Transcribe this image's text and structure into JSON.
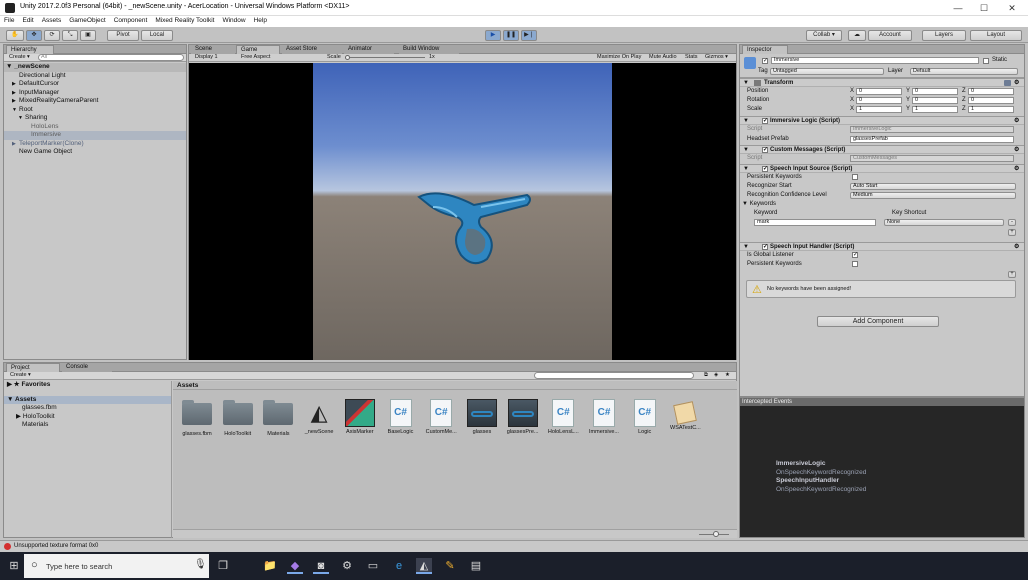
{
  "window": {
    "title": "Unity 2017.2.0f3 Personal (64bit) - _newScene.unity - AcerLocation - Universal Windows Platform <DX11>",
    "minimize": "—",
    "maximize": "☐",
    "close": "✕"
  },
  "menu": [
    "File",
    "Edit",
    "Assets",
    "GameObject",
    "Component",
    "Mixed Reality Toolkit",
    "Window",
    "Help"
  ],
  "toolbar": {
    "pivot": "Pivot",
    "local": "Local",
    "collab": "Collab ▾",
    "account": "Account",
    "layers": "Layers",
    "layout": "Layout"
  },
  "hierarchy": {
    "tab": "Hierarchy",
    "create": "Create ▾",
    "search_placeholder": "All",
    "scene": "_newScene",
    "items": [
      {
        "label": "Directional Light",
        "indent": 1,
        "arrow": ""
      },
      {
        "label": "DefaultCursor",
        "indent": 1,
        "arrow": "▶"
      },
      {
        "label": "InputManager",
        "indent": 1,
        "arrow": "▶"
      },
      {
        "label": "MixedRealityCameraParent",
        "indent": 1,
        "arrow": "▶"
      },
      {
        "label": "Root",
        "indent": 1,
        "arrow": "▼"
      },
      {
        "label": "Sharing",
        "indent": 2,
        "arrow": "▼"
      },
      {
        "label": "HoloLens",
        "indent": 3,
        "arrow": ""
      },
      {
        "label": "Immersive",
        "indent": 3,
        "arrow": ""
      },
      {
        "label": "TeleportMarker(Clone)",
        "indent": 1,
        "arrow": "▶"
      },
      {
        "label": "New Game Object",
        "indent": 1,
        "arrow": ""
      }
    ]
  },
  "center_tabs": {
    "scene": "Scene",
    "game": "Game",
    "asset_store": "Asset Store",
    "animator": "Animator",
    "build_window": "Build Window"
  },
  "game_bar": {
    "display": "Display 1",
    "aspect": "Free Aspect",
    "scale_label": "Scale",
    "scale_value": "1x",
    "maximize": "Maximize On Play",
    "mute": "Mute Audio",
    "stats": "Stats",
    "gizmos": "Gizmos ▾"
  },
  "inspector": {
    "tab": "Inspector",
    "name": "Immersive",
    "static": "Static",
    "tag_label": "Tag",
    "tag": "Untagged",
    "layer_label": "Layer",
    "layer": "Default",
    "transform": {
      "title": "Transform",
      "position": "Position",
      "rotation": "Rotation",
      "scale": "Scale",
      "pos": [
        "0",
        "0",
        "0"
      ],
      "rot": [
        "0",
        "0",
        "0"
      ],
      "scl": [
        "1",
        "1",
        "1"
      ]
    },
    "immersive_logic": {
      "title": "Immersive Logic (Script)",
      "script_label": "Script",
      "script": "ImmersiveLogic",
      "prefab_label": "Headset Prefab",
      "prefab": "glassesPrefab"
    },
    "custom_messages": {
      "title": "Custom Messages (Script)",
      "script_label": "Script",
      "script": "CustomMessages"
    },
    "speech_source": {
      "title": "Speech Input Source (Script)",
      "persistent": "Persistent Keywords",
      "recognizer_label": "Recognizer Start",
      "recognizer": "Auto Start",
      "confidence_label": "Recognition Confidence Level",
      "confidence": "Medium",
      "keywords": "Keywords",
      "keyword_col": "Keyword",
      "shortcut_col": "Key Shortcut",
      "keyword": "mark",
      "shortcut": "None"
    },
    "speech_handler": {
      "title": "Speech Input Handler (Script)",
      "global": "Is Global Listener",
      "persistent": "Persistent Keywords",
      "warning": "No keywords have been assigned!"
    },
    "add_component": "Add Component"
  },
  "events": {
    "title": "Intercepted Events",
    "lines": [
      "ImmersiveLogic",
      "OnSpeechKeywordRecognized",
      "SpeechInputHandler",
      "OnSpeechKeywordRecognized"
    ]
  },
  "project": {
    "tab": "Project",
    "console_tab": "Console",
    "create": "Create ▾",
    "favorites": "Favorites",
    "assets_root": "Assets",
    "tree": [
      "glasses.fbm",
      "HoloToolkit",
      "Materials"
    ],
    "breadcrumb": "Assets",
    "assets": [
      {
        "label": "glasses.fbm",
        "kind": "folder"
      },
      {
        "label": "HoloToolkit",
        "kind": "folder"
      },
      {
        "label": "Materials",
        "kind": "folder"
      },
      {
        "label": "_newScene",
        "kind": "unity"
      },
      {
        "label": "AxisMarker",
        "kind": "prefab"
      },
      {
        "label": "BaseLogic",
        "kind": "cs"
      },
      {
        "label": "CustomMe...",
        "kind": "cs"
      },
      {
        "label": "glasses",
        "kind": "prefab"
      },
      {
        "label": "glassesPre...",
        "kind": "prefab"
      },
      {
        "label": "HoloLensL...",
        "kind": "cs"
      },
      {
        "label": "Immersive...",
        "kind": "cs"
      },
      {
        "label": "Logic",
        "kind": "cs"
      },
      {
        "label": "WSATestC...",
        "kind": "other"
      }
    ]
  },
  "status": {
    "error": "Unsupported texture format 0x0"
  },
  "taskbar": {
    "search": "Type here to search"
  }
}
